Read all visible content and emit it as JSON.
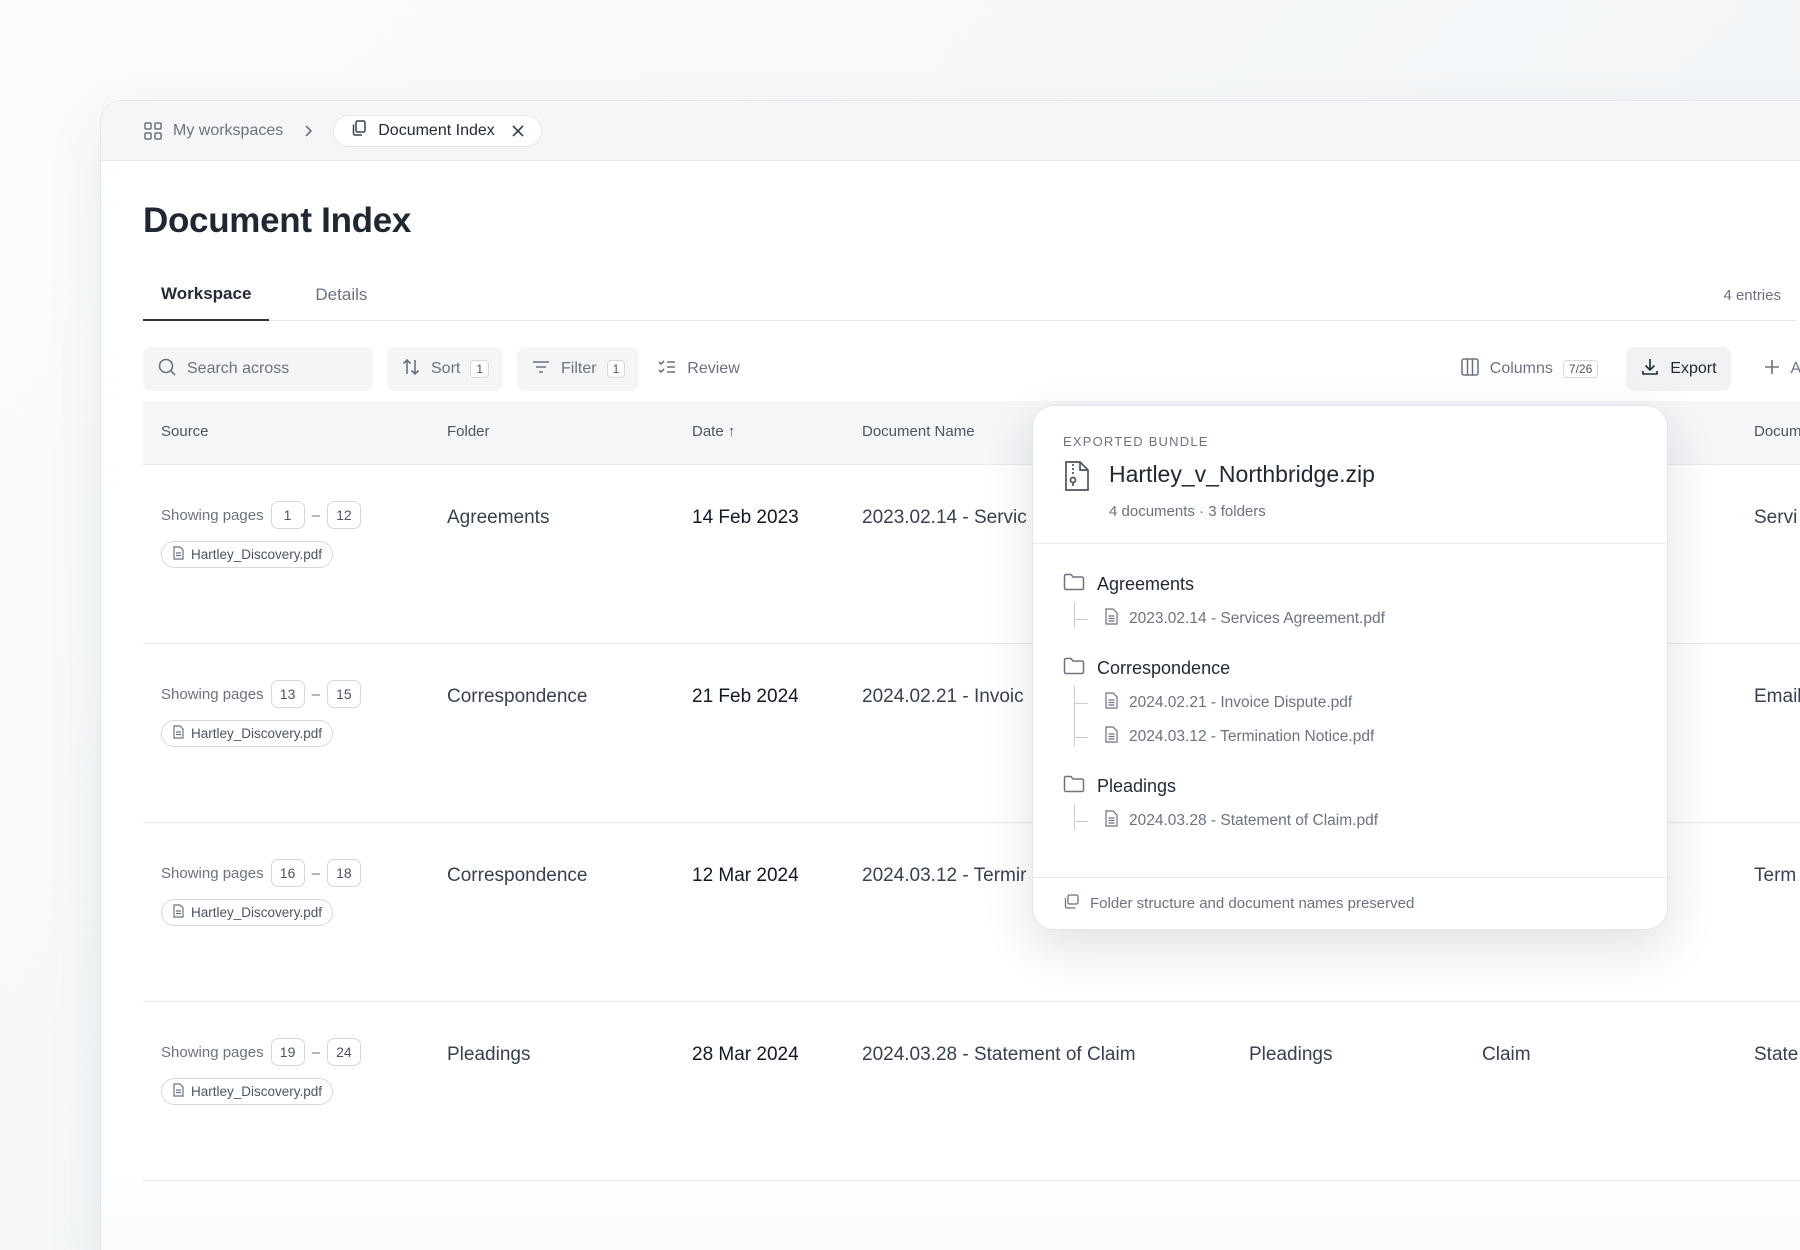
{
  "breadcrumb": {
    "workspaces_label": "My workspaces",
    "active_tab_label": "Document Index"
  },
  "page": {
    "title": "Document Index",
    "tabs": [
      {
        "label": "Workspace",
        "active": true
      },
      {
        "label": "Details",
        "active": false
      }
    ],
    "entries_count": "4 entries"
  },
  "toolbar": {
    "search_placeholder": "Search across",
    "sort_label": "Sort",
    "sort_count": "1",
    "filter_label": "Filter",
    "filter_count": "1",
    "review_label": "Review",
    "columns_label": "Columns",
    "columns_count": "7/26",
    "export_label": "Export",
    "add_entry_label": "Add entry"
  },
  "table": {
    "headers": [
      "Source",
      "Folder",
      "Date ↑",
      "Document Name",
      "Docum"
    ],
    "rows": [
      {
        "pages_label": "Showing pages",
        "page_from": "1",
        "page_to": "12",
        "file": "Hartley_Discovery.pdf",
        "folder": "Agreements",
        "date": "14 Feb 2023",
        "doc_name": "2023.02.14 - Servic",
        "col5": "",
        "col6": "",
        "doc_type": "Servi"
      },
      {
        "pages_label": "Showing pages",
        "page_from": "13",
        "page_to": "15",
        "file": "Hartley_Discovery.pdf",
        "folder": "Correspondence",
        "date": "21 Feb 2024",
        "doc_name": "2024.02.21 - Invoic",
        "col5": "",
        "col6": "",
        "doc_type": "Email"
      },
      {
        "pages_label": "Showing pages",
        "page_from": "16",
        "page_to": "18",
        "file": "Hartley_Discovery.pdf",
        "folder": "Correspondence",
        "date": "12 Mar 2024",
        "doc_name": "2024.03.12 - Termir",
        "col5": "",
        "col6": "",
        "doc_type": "Term"
      },
      {
        "pages_label": "Showing pages",
        "page_from": "19",
        "page_to": "24",
        "file": "Hartley_Discovery.pdf",
        "folder": "Pleadings",
        "date": "28 Mar 2024",
        "doc_name": "2024.03.28 - Statement of Claim",
        "col5": "Pleadings",
        "col6": "Claim",
        "doc_type": "State"
      }
    ],
    "range_dash": "–"
  },
  "export_popover": {
    "eyebrow": "EXPORTED BUNDLE",
    "title": "Hartley_v_Northbridge.zip",
    "subtitle": "4 documents · 3 folders",
    "folders": [
      {
        "name": "Agreements",
        "files": [
          "2023.02.14 - Services Agreement.pdf"
        ]
      },
      {
        "name": "Correspondence",
        "files": [
          "2024.02.21 - Invoice Dispute.pdf",
          "2024.03.12 - Termination Notice.pdf"
        ]
      },
      {
        "name": "Pleadings",
        "files": [
          "2024.03.28 - Statement of Claim.pdf"
        ]
      }
    ],
    "footer": "Folder structure and document names preserved"
  }
}
